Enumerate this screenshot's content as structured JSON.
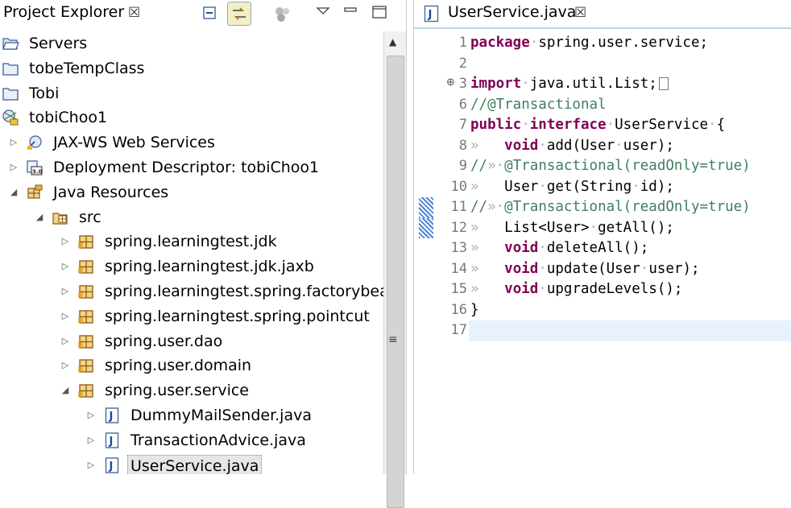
{
  "project_explorer": {
    "title": "Project Explorer",
    "close_glyph": "☒",
    "toolbar": {
      "collapse_all_icon": "collapse-all-icon",
      "link_with_editor_icon": "link-with-editor-icon",
      "focus_icon": "focus-icon",
      "view_menu_icon": "view-menu-icon",
      "minimize_icon": "minimize-icon",
      "maximize_icon": "maximize-icon"
    },
    "tree": [
      {
        "label": "Servers",
        "icon": "open-folder-icon",
        "depth": 0,
        "toggle": ""
      },
      {
        "label": "tobeTempClass",
        "icon": "closed-project-icon",
        "depth": 0,
        "toggle": ""
      },
      {
        "label": "Tobi",
        "icon": "closed-project-icon",
        "depth": 0,
        "toggle": ""
      },
      {
        "label": "tobiChoo1",
        "icon": "web-project-icon",
        "depth": 0,
        "toggle": ""
      },
      {
        "label": "JAX-WS Web Services",
        "icon": "jaxws-icon",
        "depth": 1,
        "toggle": "collapsed"
      },
      {
        "label": "Deployment Descriptor: tobiChoo1",
        "icon": "deployment-descriptor-icon",
        "depth": 1,
        "toggle": "collapsed"
      },
      {
        "label": "Java Resources",
        "icon": "java-resources-icon",
        "depth": 1,
        "toggle": "expanded"
      },
      {
        "label": "src",
        "icon": "source-folder-icon",
        "depth": 2,
        "toggle": "expanded"
      },
      {
        "label": "spring.learningtest.jdk",
        "icon": "package-icon",
        "depth": 3,
        "toggle": "collapsed"
      },
      {
        "label": "spring.learningtest.jdk.jaxb",
        "icon": "package-icon",
        "depth": 3,
        "toggle": "collapsed"
      },
      {
        "label": "spring.learningtest.spring.factorybean",
        "icon": "package-icon",
        "depth": 3,
        "toggle": "collapsed"
      },
      {
        "label": "spring.learningtest.spring.pointcut",
        "icon": "package-icon",
        "depth": 3,
        "toggle": "collapsed"
      },
      {
        "label": "spring.user.dao",
        "icon": "package-icon",
        "depth": 3,
        "toggle": "collapsed"
      },
      {
        "label": "spring.user.domain",
        "icon": "package-icon",
        "depth": 3,
        "toggle": "collapsed"
      },
      {
        "label": "spring.user.service",
        "icon": "package-icon",
        "depth": 3,
        "toggle": "expanded"
      },
      {
        "label": "DummyMailSender.java",
        "icon": "java-file-icon",
        "depth": 4,
        "toggle": "collapsed"
      },
      {
        "label": "TransactionAdvice.java",
        "icon": "java-file-icon",
        "depth": 4,
        "toggle": "collapsed"
      },
      {
        "label": "UserService.java",
        "icon": "java-file-icon",
        "depth": 4,
        "toggle": "collapsed",
        "selected": true
      }
    ],
    "scrollbar": {
      "up_glyph": "▲",
      "grip_glyph": "≡"
    }
  },
  "editor": {
    "tab_title": "UserService.java",
    "tab_icon": "java-file-icon",
    "close_glyph": "☒",
    "fold_glyph": "⊕",
    "lines": [
      {
        "num": "1",
        "tokens": [
          {
            "t": "package",
            "c": "kw"
          },
          {
            "t": "·",
            "c": "ws"
          },
          {
            "t": "spring.user.service;",
            "c": ""
          }
        ]
      },
      {
        "num": "2",
        "tokens": []
      },
      {
        "num": "3",
        "folded": true,
        "tokens": [
          {
            "t": "import",
            "c": "kw"
          },
          {
            "t": "·",
            "c": "ws"
          },
          {
            "t": "java.util.List;",
            "c": ""
          }
        ]
      },
      {
        "num": "6",
        "tokens": [
          {
            "t": "//@Transactional",
            "c": "cm"
          }
        ]
      },
      {
        "num": "7",
        "tokens": [
          {
            "t": "public",
            "c": "kw"
          },
          {
            "t": "·",
            "c": "ws"
          },
          {
            "t": "interface",
            "c": "kw"
          },
          {
            "t": "·",
            "c": "ws"
          },
          {
            "t": "UserService",
            "c": ""
          },
          {
            "t": "·",
            "c": "ws"
          },
          {
            "t": "{",
            "c": ""
          }
        ]
      },
      {
        "num": "8",
        "tokens": [
          {
            "t": "»   ",
            "c": "ws"
          },
          {
            "t": "void",
            "c": "kw"
          },
          {
            "t": "·",
            "c": "ws"
          },
          {
            "t": "add(User",
            "c": ""
          },
          {
            "t": "·",
            "c": "ws"
          },
          {
            "t": "user);",
            "c": ""
          }
        ]
      },
      {
        "num": "9",
        "tokens": [
          {
            "t": "//",
            "c": "cm"
          },
          {
            "t": "»",
            "c": "ws"
          },
          {
            "t": "·",
            "c": "ws"
          },
          {
            "t": "@Transactional(readOnly=true)",
            "c": "cm"
          }
        ]
      },
      {
        "num": "10",
        "tokens": [
          {
            "t": "»   ",
            "c": "ws"
          },
          {
            "t": "User",
            "c": ""
          },
          {
            "t": "·",
            "c": "ws"
          },
          {
            "t": "get(String",
            "c": ""
          },
          {
            "t": "·",
            "c": "ws"
          },
          {
            "t": "id);",
            "c": ""
          }
        ]
      },
      {
        "num": "11",
        "tokens": [
          {
            "t": "//",
            "c": "cm"
          },
          {
            "t": "»",
            "c": "ws"
          },
          {
            "t": "·",
            "c": "ws"
          },
          {
            "t": "@Transactional(readOnly=true)",
            "c": "cm"
          }
        ]
      },
      {
        "num": "12",
        "tokens": [
          {
            "t": "»   ",
            "c": "ws"
          },
          {
            "t": "List<User>",
            "c": ""
          },
          {
            "t": "·",
            "c": "ws"
          },
          {
            "t": "getAll();",
            "c": ""
          }
        ]
      },
      {
        "num": "13",
        "tokens": [
          {
            "t": "»   ",
            "c": "ws"
          },
          {
            "t": "void",
            "c": "kw"
          },
          {
            "t": "·",
            "c": "ws"
          },
          {
            "t": "deleteAll();",
            "c": ""
          }
        ]
      },
      {
        "num": "14",
        "tokens": [
          {
            "t": "»   ",
            "c": "ws"
          },
          {
            "t": "void",
            "c": "kw"
          },
          {
            "t": "·",
            "c": "ws"
          },
          {
            "t": "update(User",
            "c": ""
          },
          {
            "t": "·",
            "c": "ws"
          },
          {
            "t": "user);",
            "c": ""
          }
        ]
      },
      {
        "num": "15",
        "tokens": [
          {
            "t": "»   ",
            "c": "ws"
          },
          {
            "t": "void",
            "c": "kw"
          },
          {
            "t": "·",
            "c": "ws"
          },
          {
            "t": "upgradeLevels();",
            "c": ""
          }
        ]
      },
      {
        "num": "16",
        "tokens": [
          {
            "t": "}",
            "c": ""
          }
        ]
      },
      {
        "num": "17",
        "tokens": [],
        "current": true
      }
    ],
    "change_marker_lines": [
      "11",
      "12"
    ],
    "colors": {
      "keyword": "#7f0055",
      "comment": "#3f7f5f",
      "line_number": "#787878",
      "current_line": "#e8f2fe"
    }
  }
}
